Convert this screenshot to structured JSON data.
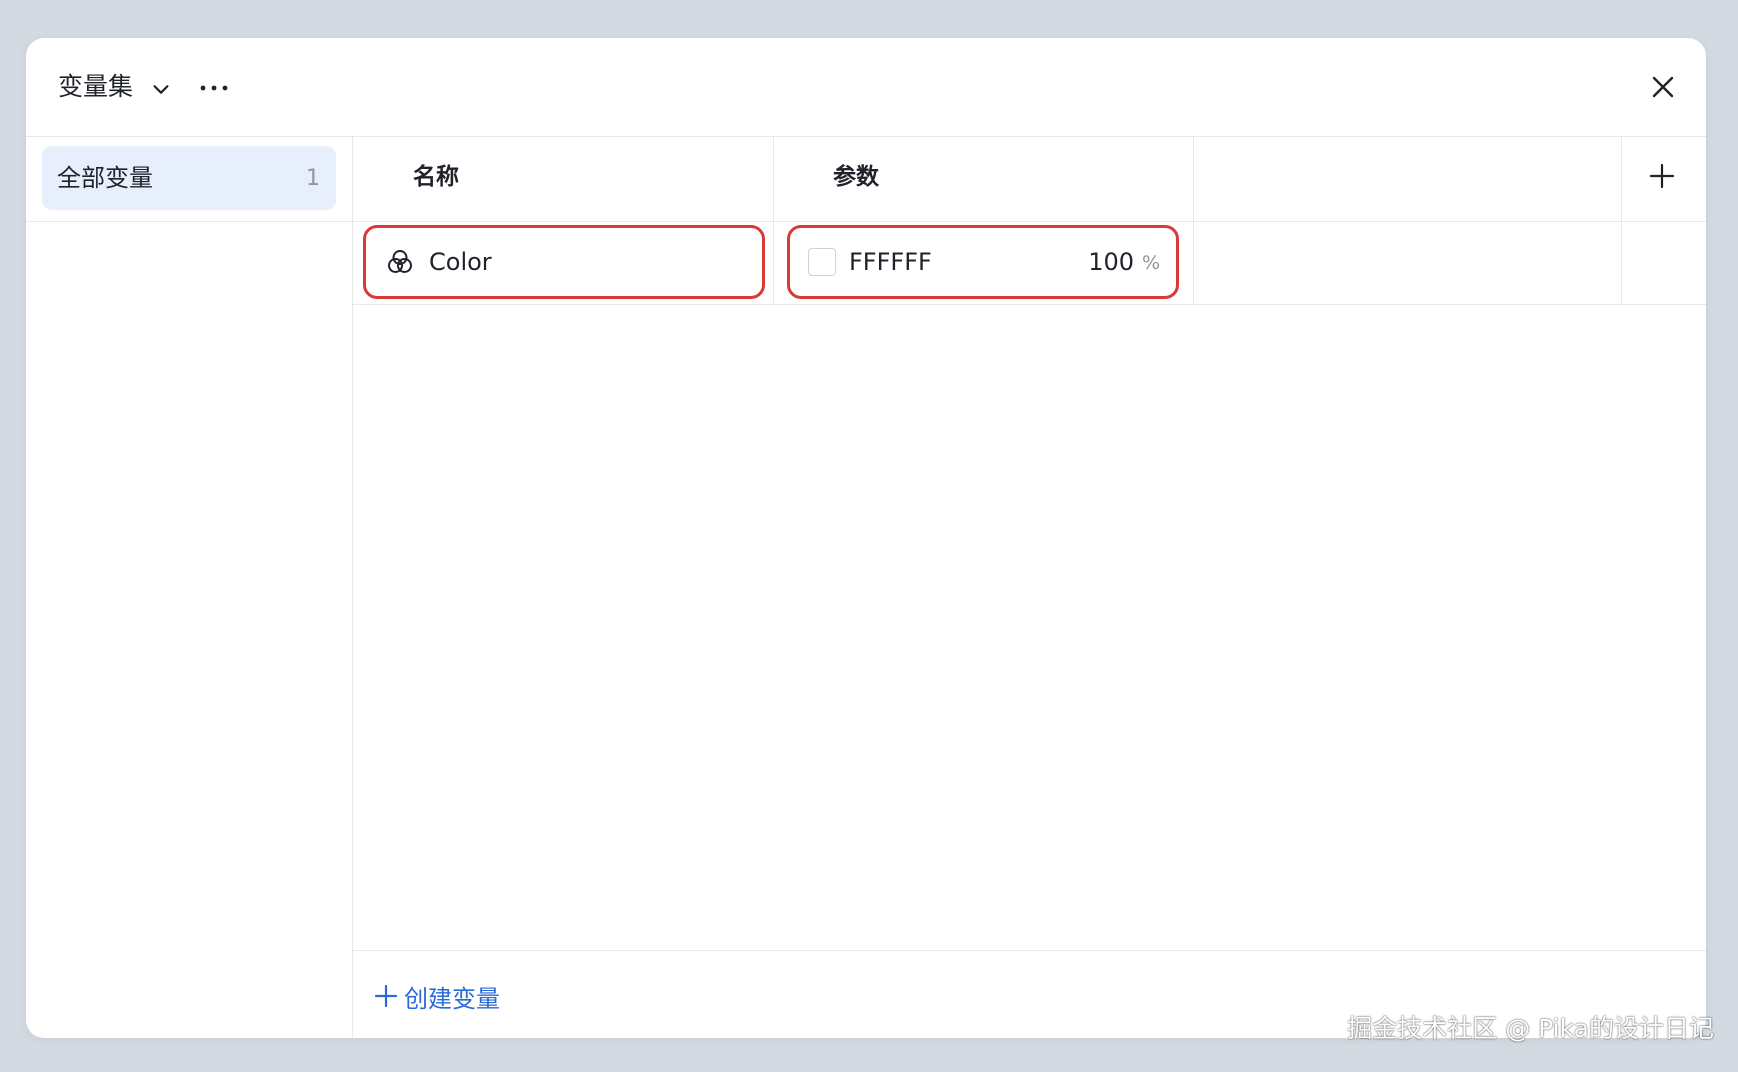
{
  "header": {
    "title": "变量集",
    "icons": [
      "chevron-down-icon",
      "more-icon",
      "close-icon"
    ]
  },
  "sidebar": {
    "items": [
      {
        "label": "全部变量",
        "count": "1"
      }
    ]
  },
  "table": {
    "columns": [
      "名称",
      "参数"
    ],
    "add_column_icon": "plus-icon",
    "rows": [
      {
        "name": "Color",
        "icon": "color-variable-icon",
        "value": "FFFFFF",
        "opacity": "100",
        "opacity_unit": "%"
      }
    ]
  },
  "footer": {
    "create_label": "创建变量",
    "create_icon": "plus-icon"
  },
  "watermark": "掘金技术社区 @ Pika的设计日记",
  "colors": {
    "accent": "#2a6bd9",
    "highlight_outline": "#d93a35",
    "sidebar_selected_bg": "#e7effd",
    "swatch": "#FFFFFF"
  }
}
